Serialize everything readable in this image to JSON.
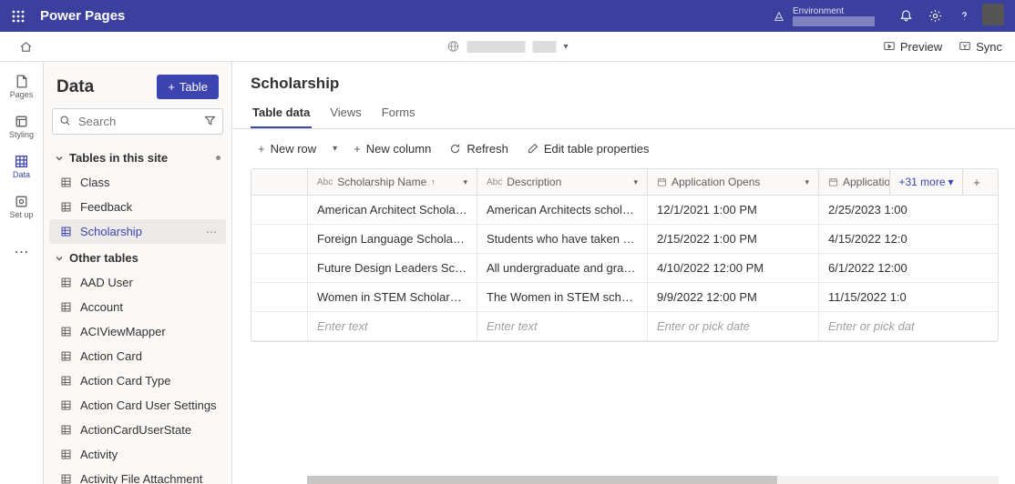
{
  "header": {
    "product_name": "Power Pages",
    "env_label": "Environment",
    "preview_label": "Preview",
    "sync_label": "Sync"
  },
  "rail": {
    "items": [
      {
        "id": "pages",
        "label": "Pages"
      },
      {
        "id": "styling",
        "label": "Styling"
      },
      {
        "id": "data",
        "label": "Data"
      },
      {
        "id": "setup",
        "label": "Set up"
      }
    ]
  },
  "panel": {
    "title": "Data",
    "table_btn": "Table",
    "search_placeholder": "Search",
    "section1_title": "Tables in this site",
    "section2_title": "Other tables",
    "site_tables": [
      {
        "label": "Class"
      },
      {
        "label": "Feedback"
      },
      {
        "label": "Scholarship",
        "selected": true
      }
    ],
    "other_tables": [
      {
        "label": "AAD User"
      },
      {
        "label": "Account"
      },
      {
        "label": "ACIViewMapper"
      },
      {
        "label": "Action Card"
      },
      {
        "label": "Action Card Type"
      },
      {
        "label": "Action Card User Settings"
      },
      {
        "label": "ActionCardUserState"
      },
      {
        "label": "Activity"
      },
      {
        "label": "Activity File Attachment"
      }
    ]
  },
  "main": {
    "title": "Scholarship",
    "tabs": [
      {
        "label": "Table data",
        "active": true
      },
      {
        "label": "Views"
      },
      {
        "label": "Forms"
      }
    ],
    "toolbar": {
      "new_row": "New row",
      "new_column": "New column",
      "refresh": "Refresh",
      "edit_props": "Edit table properties"
    },
    "columns": {
      "name": "Scholarship Name",
      "desc": "Description",
      "open": "Application Opens",
      "due": "Application D",
      "more": "+31 more"
    },
    "rows": [
      {
        "name": "American Architect Scholarship",
        "desc": "American Architects scholarship is…",
        "open": "12/1/2021 1:00 PM",
        "due": "2/25/2023 1:00"
      },
      {
        "name": "Foreign Language Scholarship",
        "desc": "Students who have taken at least …",
        "open": "2/15/2022 1:00 PM",
        "due": "4/15/2022 12:0"
      },
      {
        "name": "Future Design Leaders Scholarship",
        "desc": "All undergraduate and graduate s…",
        "open": "4/10/2022 12:00 PM",
        "due": "6/1/2022 12:00"
      },
      {
        "name": "Women in STEM Scholarship",
        "desc": "The Women in STEM scholarship i…",
        "open": "9/9/2022 12:00 PM",
        "due": "11/15/2022 1:0"
      }
    ],
    "new_row_placeholders": {
      "text": "Enter text",
      "date": "Enter or pick date",
      "date_trunc": "Enter or pick dat"
    }
  }
}
